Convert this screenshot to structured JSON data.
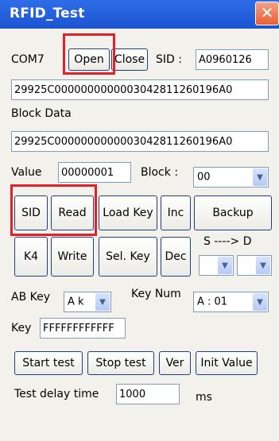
{
  "window": {
    "title": "RFID_Test",
    "close_label": "✕"
  },
  "port": {
    "label": "COM7",
    "open_label": "Open",
    "close_label": "Close"
  },
  "sid": {
    "label": "SID :",
    "value": "A0960126"
  },
  "uid_value": "29925C0000000000003042811260196A0",
  "block_data": {
    "label": "Block Data",
    "value": "29925C0000000000003042811260196A0"
  },
  "value_field": {
    "label": "Value",
    "value": "00000001"
  },
  "block": {
    "label": "Block :",
    "selected": "00"
  },
  "buttons": {
    "sid": "SID",
    "read": "Read",
    "load_key": "Load Key",
    "inc": "Inc",
    "backup": "Backup",
    "k4": "K4",
    "write": "Write",
    "sel_key": "Sel. Key",
    "dec": "Dec"
  },
  "transfer": {
    "label": "S ----> D",
    "source": "",
    "dest": ""
  },
  "ab_key": {
    "label": "AB Key",
    "selected": "A k"
  },
  "key_num": {
    "label": "Key Num",
    "selected": "A : 01"
  },
  "key": {
    "label": "Key",
    "value": "FFFFFFFFFFFF"
  },
  "tests": {
    "start": "Start test",
    "stop": "Stop test",
    "ver": "Ver",
    "init": "Init Value"
  },
  "delay": {
    "label": "Test delay time",
    "value": "1000",
    "unit": "ms"
  },
  "colors": {
    "titlebar": "#1c54d0",
    "highlight": "#e2202a",
    "background": "#f2f1eb"
  }
}
